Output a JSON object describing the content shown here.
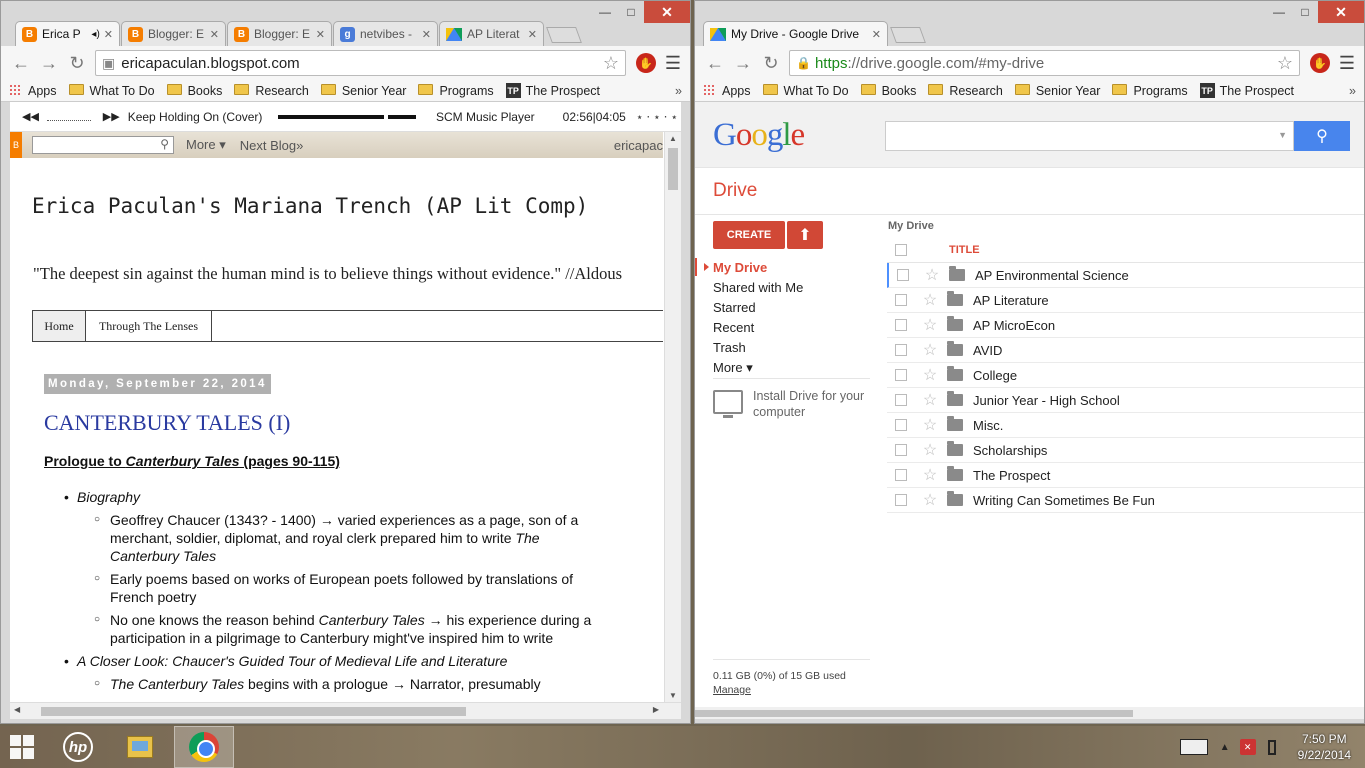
{
  "left_window": {
    "tabs": [
      {
        "title": "Erica P",
        "fav": "B",
        "active": true,
        "audio": "◂)"
      },
      {
        "title": "Blogger: E",
        "fav": "B",
        "active": false
      },
      {
        "title": "Blogger: E",
        "fav": "B",
        "active": false
      },
      {
        "title": "netvibes -",
        "fav": "g",
        "active": false
      },
      {
        "title": "AP Literat",
        "fav": "drive",
        "active": false
      }
    ],
    "url": "ericapaculan.blogspot.com",
    "bookmarks": [
      "Apps",
      "What To Do",
      "Books",
      "Research",
      "Senior Year",
      "Programs",
      "The Prospect"
    ],
    "music": {
      "song": "Keep Holding On (Cover)",
      "player": "SCM Music Player",
      "time": "02:56|04:05",
      "progress": 0.72
    },
    "navbar": {
      "more": "More ▾",
      "next": "Next Blog»",
      "user": "ericapac"
    },
    "blog": {
      "title": "Erica Paculan's Mariana Trench (AP Lit Comp)",
      "description": "\"The deepest sin against the human mind is to believe things without evidence.\" //Aldous",
      "pages": [
        "Home",
        "Through The Lenses"
      ],
      "date": "Monday, September 22, 2014",
      "post_title": "CANTERBURY TALES (I)",
      "subtitle_pre": "Prologue to ",
      "subtitle_em": "Canterbury Tales",
      "subtitle_post": " (pages 90-115)",
      "items": {
        "b1": "Biography",
        "b1a_1": "Geoffrey Chaucer (1343? - 1400) → varied experiences as a page, son of a merchant, soldier, diplomat, and royal clerk prepared him to write ",
        "b1a_em": "The Canterbury Tales",
        "b1b": "Early poems based on works of European poets followed by translations of French poetry",
        "b1c_1": "No one knows the reason behind ",
        "b1c_em": "Canterbury Tales",
        "b1c_2": " → his experience during a participation in a pilgrimage to Canterbury might've inspired him to write",
        "b2": "A Closer Look: Chaucer's Guided Tour of Medieval Life and Literature",
        "b2a_em": "The Canterbury Tales",
        "b2a_2": " begins with a prologue → Narrator, presumably"
      }
    }
  },
  "right_window": {
    "tab_title": "My Drive - Google Drive",
    "url_https": "https",
    "url_rest": "://drive.google.com/#my-drive",
    "bookmarks": [
      "Apps",
      "What To Do",
      "Books",
      "Research",
      "Senior Year",
      "Programs",
      "The Prospect"
    ],
    "drive": {
      "title": "Drive",
      "create": "CREATE",
      "nav": [
        "My Drive",
        "Shared with Me",
        "Starred",
        "Recent",
        "Trash",
        "More ▾"
      ],
      "install": "Install Drive for your computer",
      "quota": "0.11 GB (0%) of 15 GB used",
      "manage": "Manage",
      "breadcrumb": "My Drive",
      "column_title": "TITLE",
      "folders": [
        "AP Environmental Science",
        "AP Literature",
        "AP MicroEcon",
        "AVID",
        "College",
        "Junior Year - High School",
        "Misc.",
        "Scholarships",
        "The Prospect",
        "Writing Can Sometimes Be Fun"
      ]
    }
  },
  "taskbar": {
    "time": "7:50 PM",
    "date": "9/22/2014"
  },
  "colors": {
    "drive_red": "#dd4b39",
    "search_blue": "#4885ed",
    "blog_title_blue": "#2a3aa0"
  }
}
